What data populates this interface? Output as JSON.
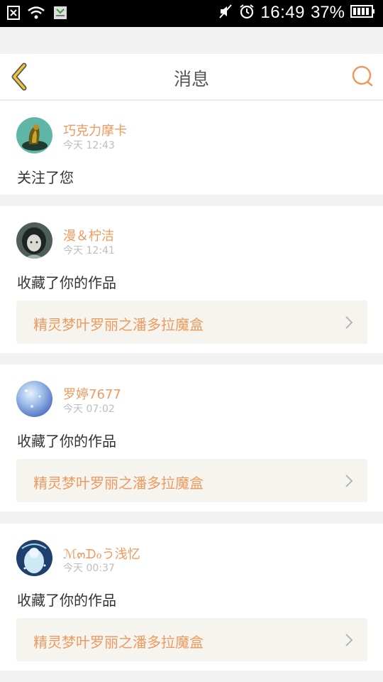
{
  "status_bar": {
    "time": "16:49",
    "battery": "37%"
  },
  "header": {
    "title": "消息"
  },
  "colors": {
    "accent": "#ee9a5e",
    "back_arrow": "#f0c63a",
    "work_bg": "#f5f4ee"
  },
  "messages": [
    {
      "user": "巧克力摩卡",
      "time": "今天 12:43",
      "action": "关注了您"
    },
    {
      "user": "漫＆柠洁",
      "time": "今天 12:41",
      "action": "收藏了你的作品",
      "work": "精灵梦叶罗丽之潘多拉魔盒"
    },
    {
      "user": "罗婷7677",
      "time": "今天 07:02",
      "action": "收藏了你的作品",
      "work": "精灵梦叶罗丽之潘多拉魔盒"
    },
    {
      "user": "ℳ๓ᗪℴう浅忆",
      "time": "今天 00:37",
      "action": "收藏了你的作品",
      "work": "精灵梦叶罗丽之潘多拉魔盒"
    }
  ]
}
